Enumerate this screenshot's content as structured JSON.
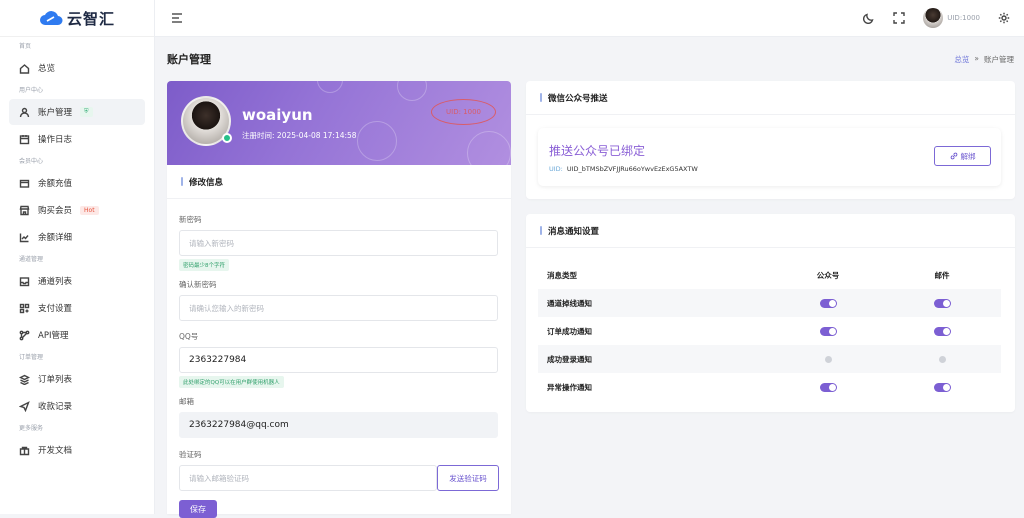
{
  "brand": {
    "name": "云智汇",
    "accent": "#7c5fd3"
  },
  "sidebar": {
    "sections": [
      {
        "title": "首页",
        "items": [
          {
            "label": "总览",
            "icon": "home-icon"
          }
        ]
      },
      {
        "title": "用户中心",
        "items": [
          {
            "label": "账户管理",
            "icon": "user-icon",
            "badge": "shield",
            "active": true
          },
          {
            "label": "操作日志",
            "icon": "calendar-icon"
          }
        ]
      },
      {
        "title": "会员中心",
        "items": [
          {
            "label": "余额充值",
            "icon": "wallet-icon"
          },
          {
            "label": "购买会员",
            "icon": "store-icon",
            "badge": "Hot"
          },
          {
            "label": "余额详细",
            "icon": "chart-line-icon"
          }
        ]
      },
      {
        "title": "通道管理",
        "items": [
          {
            "label": "通道列表",
            "icon": "inbox-icon"
          },
          {
            "label": "支付设置",
            "icon": "grid-icon"
          },
          {
            "label": "API管理",
            "icon": "network-icon"
          }
        ]
      },
      {
        "title": "订单管理",
        "items": [
          {
            "label": "订单列表",
            "icon": "layers-icon"
          },
          {
            "label": "收款记录",
            "icon": "send-icon"
          }
        ]
      },
      {
        "title": "更多服务",
        "items": [
          {
            "label": "开发文档",
            "icon": "document-icon"
          }
        ]
      }
    ]
  },
  "topbar": {
    "uid": "UID:1000"
  },
  "page": {
    "title": "账户管理",
    "breadcrumb": {
      "home": "总览",
      "sep": "»",
      "current": "账户管理"
    }
  },
  "profile": {
    "username": "woaiyun",
    "reg_label": "注册时间:",
    "reg_time": "2025-04-08 17:14:58",
    "uid_stamp": "UID: 1000"
  },
  "form": {
    "title": "修改信息",
    "new_password": {
      "label": "新密码",
      "placeholder": "请输入新密码",
      "hint": "密码最少8个字符"
    },
    "confirm_password": {
      "label": "确认新密码",
      "placeholder": "请确认您输入的新密码"
    },
    "qq": {
      "label": "QQ号",
      "value": "2363227984",
      "hint": "此处绑定的QQ可以在用户群使用机器人"
    },
    "email": {
      "label": "邮箱",
      "value": "2363227984@qq.com"
    },
    "code": {
      "label": "验证码",
      "placeholder": "请输入邮箱验证码",
      "send_label": "发送验证码"
    },
    "save_label": "保存"
  },
  "wechat": {
    "title": "微信公众号推送",
    "status": "推送公众号已绑定",
    "uid_key": "UID:",
    "uid_value": "UID_bTMSbZVFJJRu66oYwvEzExG5AXTW",
    "unbind_label": "解绑"
  },
  "notifications": {
    "title": "消息通知设置",
    "headers": [
      "消息类型",
      "公众号",
      "邮件"
    ],
    "rows": [
      {
        "label": "通道掉线通知",
        "wechat": true,
        "email": true
      },
      {
        "label": "订单成功通知",
        "wechat": true,
        "email": true
      },
      {
        "label": "成功登录通知",
        "wechat": false,
        "email": false
      },
      {
        "label": "异常操作通知",
        "wechat": true,
        "email": true
      }
    ]
  }
}
